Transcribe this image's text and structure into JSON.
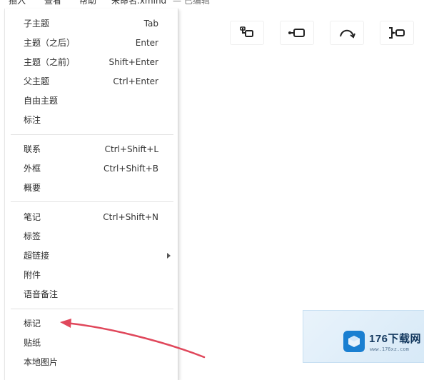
{
  "menubar": {
    "items": [
      "插入",
      "查看",
      "帮助"
    ],
    "filename": "未命名.xmind",
    "status": "— 已编辑"
  },
  "toolbar": {
    "buttons": [
      {
        "icon": "insert-subtopic-icon"
      },
      {
        "icon": "insert-topic-after-icon"
      },
      {
        "icon": "relationship-icon"
      },
      {
        "icon": "summary-icon"
      }
    ]
  },
  "menu": {
    "group1": [
      {
        "label": "子主题",
        "shortcut": "Tab"
      },
      {
        "label": "主题（之后）",
        "shortcut": "Enter"
      },
      {
        "label": "主题（之前）",
        "shortcut": "Shift+Enter"
      },
      {
        "label": "父主题",
        "shortcut": "Ctrl+Enter"
      },
      {
        "label": "自由主题",
        "shortcut": ""
      },
      {
        "label": "标注",
        "shortcut": ""
      }
    ],
    "group2": [
      {
        "label": "联系",
        "shortcut": "Ctrl+Shift+L"
      },
      {
        "label": "外框",
        "shortcut": "Ctrl+Shift+B"
      },
      {
        "label": "概要",
        "shortcut": ""
      }
    ],
    "group3": [
      {
        "label": "笔记",
        "shortcut": "Ctrl+Shift+N"
      },
      {
        "label": "标签",
        "shortcut": ""
      },
      {
        "label": "超链接",
        "shortcut": ""
      },
      {
        "label": "附件",
        "shortcut": ""
      },
      {
        "label": "语音备注",
        "shortcut": ""
      }
    ],
    "group4": [
      {
        "label": "标记",
        "shortcut": ""
      },
      {
        "label": "贴纸",
        "shortcut": ""
      },
      {
        "label": "本地图片",
        "shortcut": ""
      }
    ]
  },
  "watermark": {
    "title": "176下载网",
    "url": "www.176xz.com"
  },
  "colors": {
    "annotation": "#e0475b",
    "watermark_blue": "#1a7fd1"
  }
}
